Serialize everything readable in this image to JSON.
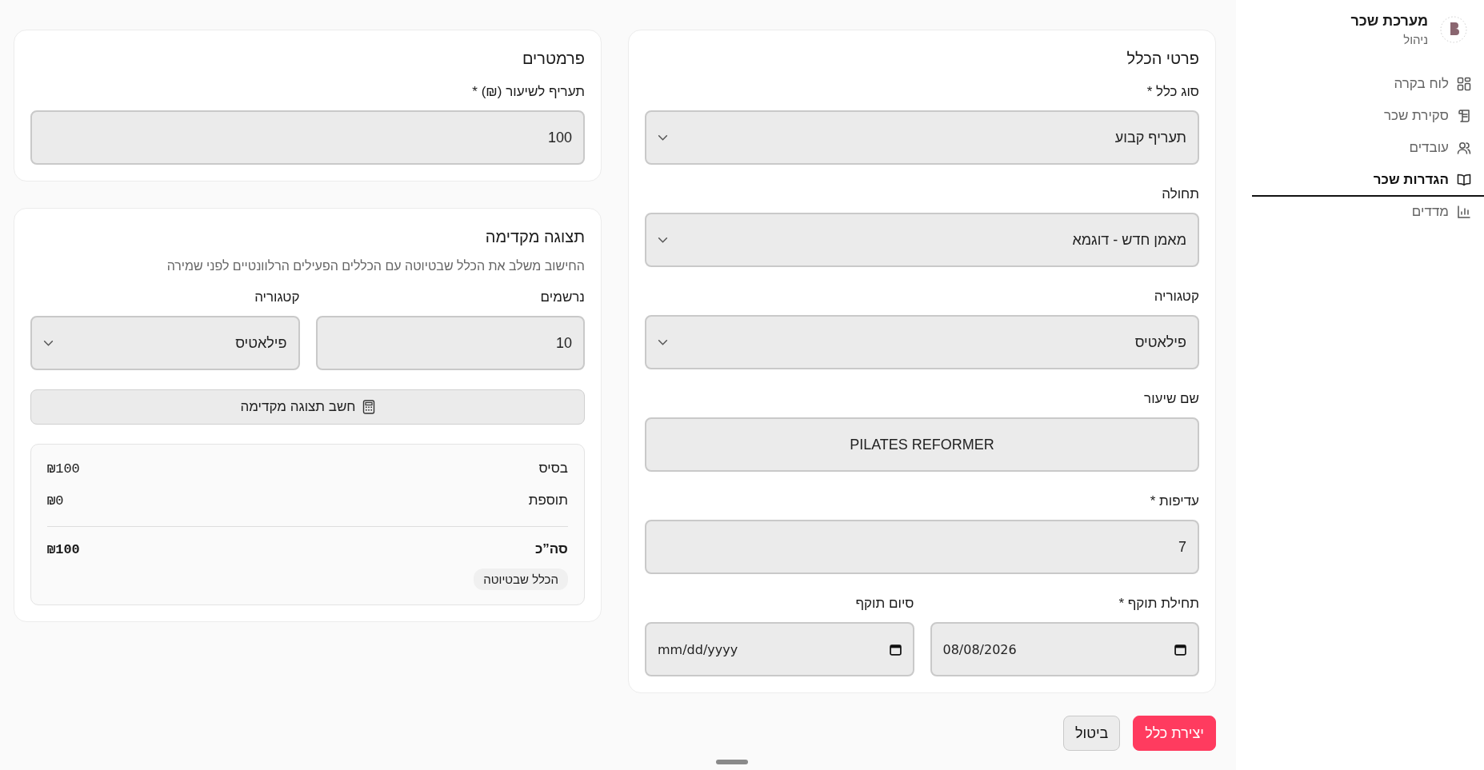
{
  "sidebar": {
    "title": "מערכת שכר",
    "subtitle": "ניהול",
    "items": [
      {
        "label": "לוח בקרה",
        "kind": "grid",
        "selected": false
      },
      {
        "label": "סקירת שכר",
        "kind": "scroll",
        "selected": false
      },
      {
        "label": "עובדים",
        "kind": "users",
        "selected": false
      },
      {
        "label": "הגדרות שכר",
        "kind": "book",
        "selected": true
      },
      {
        "label": "מדדים",
        "kind": "chart",
        "selected": false
      }
    ]
  },
  "rule_details": {
    "title": "פרטי הכלל",
    "fields": [
      {
        "label": "סוג כלל *",
        "kind": "select",
        "value": "תעריף קבוע"
      },
      {
        "label": "תחולה",
        "kind": "select",
        "value": "מאמן חדש - דוגמא"
      },
      {
        "label": "קטגוריה",
        "kind": "select",
        "value": "פילאטיס"
      },
      {
        "label": "שם שיעור",
        "kind": "text",
        "value": "PILATES REFORMER"
      },
      {
        "label": "עדיפות *",
        "kind": "number",
        "value": "7"
      }
    ],
    "dates": [
      {
        "label": "תחילת תוקף *",
        "kind": "date",
        "value": "08/08/2026"
      },
      {
        "label": "סיום תוקף",
        "kind": "date",
        "placeholder": "mm/dd/yyyy"
      }
    ]
  },
  "parameters": {
    "title": "פרמטרים",
    "fields": [
      {
        "label": "תעריף לשיעור (₪) *",
        "kind": "number",
        "value": "100"
      }
    ]
  },
  "preview": {
    "title": "תצוגה מקדימה",
    "description": "החישוב משלב את הכלל שבטיוטה עם הכללים הפעילים הרלוונטיים לפני שמירה",
    "fields": [
      {
        "label": "נרשמים",
        "kind": "number",
        "value": "10"
      },
      {
        "label": "קטגוריה",
        "kind": "select",
        "value": "פילאטיס"
      }
    ],
    "button": "חשב תצוגה מקדימה",
    "lines": [
      {
        "label": "בסיס",
        "amount": "₪100"
      },
      {
        "label": "תוספת",
        "amount": "₪0"
      }
    ],
    "total": {
      "label": "סה”כ",
      "amount": "₪100"
    },
    "tag": "הכלל שבטיוטה"
  },
  "actions": [
    {
      "label": "יצירת כלל",
      "kind": "primary"
    },
    {
      "label": "ביטול",
      "kind": "secondary"
    }
  ]
}
